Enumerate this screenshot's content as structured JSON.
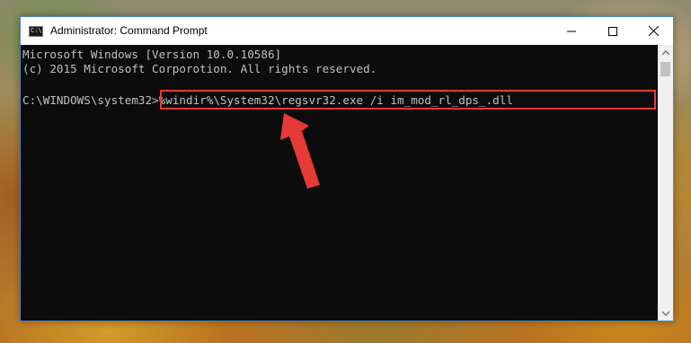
{
  "window": {
    "title": "Administrator: Command Prompt",
    "icon": "cmd-icon",
    "icon_glyph": "C:\\",
    "controls": [
      "minimize-icon",
      "maximize-icon",
      "close-icon"
    ]
  },
  "console": {
    "line1": "Microsoft Windows [Version 10.0.10586]",
    "line2": "(c) 2015 Microsoft Corporotion. All rights reserved.",
    "prompt": "C:\\WINDOWS\\system32>",
    "command": "%windir%\\System32\\regsvr32.exe /i im_mod_rl_dps_.dll"
  },
  "colors": {
    "console_bg": "#0c0c0c",
    "console_text": "#c0c0c0",
    "highlight": "#e53a35",
    "window_border": "#4a86c8"
  }
}
